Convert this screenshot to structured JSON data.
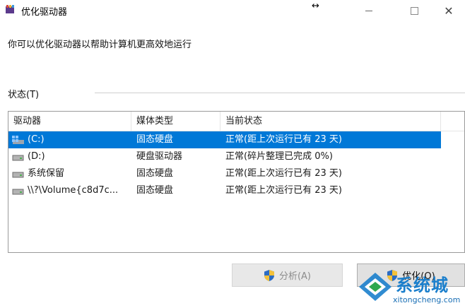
{
  "window": {
    "title": "优化驱动器",
    "resize_cursor": "↔"
  },
  "description": "你可以优化驱动器以帮助计算机更高效地运行",
  "status_label": "状态(T)",
  "table": {
    "columns": [
      "驱动器",
      "媒体类型",
      "当前状态"
    ],
    "rows": [
      {
        "drive": "(C:)",
        "media": "固态硬盘",
        "status": "正常(距上次运行已有 23 天)",
        "icon": "windows-drive-icon",
        "selected": true
      },
      {
        "drive": "(D:)",
        "media": "硬盘驱动器",
        "status": "正常(碎片整理已完成 0%)",
        "icon": "drive-icon",
        "selected": false
      },
      {
        "drive": "系统保留",
        "media": "固态硬盘",
        "status": "正常(距上次运行已有 23 天)",
        "icon": "drive-icon",
        "selected": false
      },
      {
        "drive": "\\\\?\\Volume{c8d7c...",
        "media": "固态硬盘",
        "status": "正常(距上次运行已有 23 天)",
        "icon": "drive-icon",
        "selected": false
      }
    ]
  },
  "buttons": {
    "analyze": "分析(A)",
    "optimize": "优化(O)"
  },
  "watermark": {
    "text": "系统城",
    "domain": "xitongcheng.com"
  },
  "colors": {
    "selection": "#0078d7",
    "watermark": "#1b7fcc"
  }
}
